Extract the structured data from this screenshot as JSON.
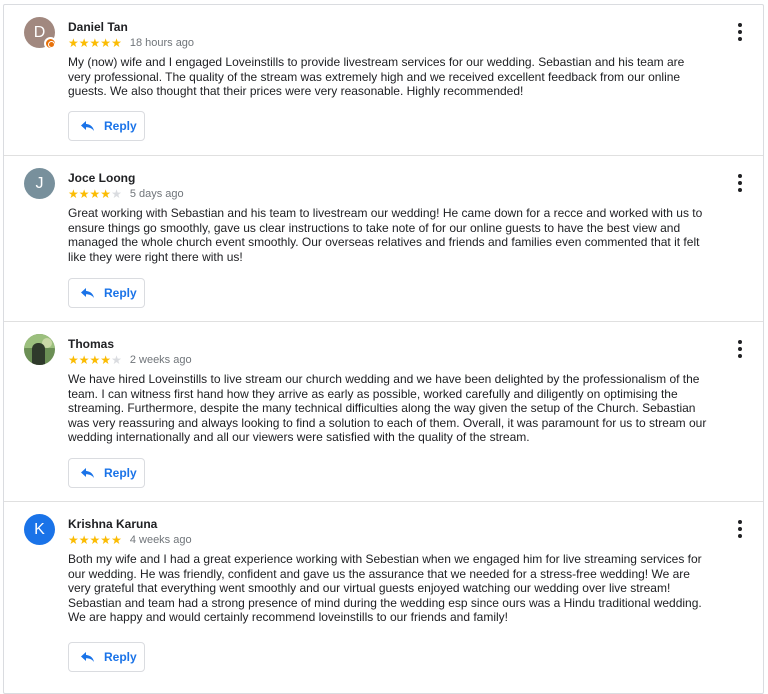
{
  "reviews": [
    {
      "name": "Daniel Tan",
      "avatar_letter": "D",
      "avatar_color": "#a1887f",
      "has_badge": true,
      "rating": 5,
      "time": "18 hours ago",
      "text": "My (now) wife and I engaged Loveinstills to provide livestream services for our wedding. Sebastian and his team are very professional. The quality of the stream was extremely high and we received excellent feedback from our online guests. We also thought that their prices were very reasonable. Highly recommended!",
      "reply_label": "Reply"
    },
    {
      "name": "Joce Loong",
      "avatar_letter": "J",
      "avatar_color": "#78909c",
      "has_badge": false,
      "rating": 4,
      "time": "5 days ago",
      "text": "Great working with Sebastian and his team to livestream our wedding! He came down for a recce and worked with us to ensure things go smoothly, gave us clear instructions to take note of for our online guests to have the best view and managed the whole church event smoothly. Our overseas relatives and friends and families even commented that it felt like they were right there with us!",
      "reply_label": "Reply"
    },
    {
      "name": "Thomas",
      "avatar_letter": "",
      "avatar_color": "#6b8f55",
      "has_badge": false,
      "rating": 4,
      "time": "2 weeks ago",
      "text": "We have hired Loveinstills to live stream our church wedding and we have been delighted by the professionalism of the team. I can witness first hand how they arrive as early as possible, worked carefully and diligently on optimising the streaming. Furthermore, despite the many technical difficulties along the way given the setup of the Church. Sebastian was very reassuring and always looking to find a solution to each of them. Overall, it was paramount for us to stream our wedding internationally and all our viewers were satisfied with the quality of the stream.",
      "reply_label": "Reply"
    },
    {
      "name": "Krishna Karuna",
      "avatar_letter": "K",
      "avatar_color": "#1a73e8",
      "has_badge": false,
      "rating": 5,
      "time": "4 weeks ago",
      "text": "Both my wife and I had a great experience working with Sebestian when we engaged him for live streaming services for our wedding. He was friendly, confident and gave us the assurance that we needed for a stress-free wedding! We are very grateful that everything went smoothly and our virtual guests enjoyed watching our wedding over live stream! Sebastian and team had a strong presence of mind during the wedding esp since ours was a Hindu traditional wedding. We are happy and would certainly recommend loveinstills to our friends and family!",
      "reply_label": "Reply"
    }
  ],
  "icons": {
    "reply": "reply-arrow-icon",
    "more": "more-vertical-icon",
    "star": "star-icon"
  },
  "colors": {
    "accent": "#1a73e8",
    "star_on": "#fbbc04",
    "star_off": "#dadce0"
  }
}
